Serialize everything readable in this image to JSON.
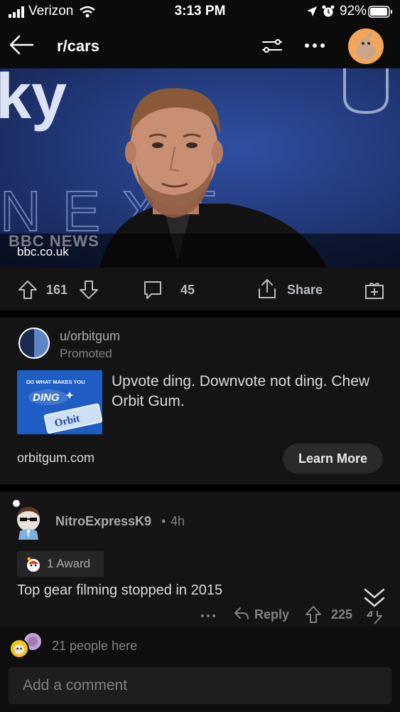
{
  "status": {
    "carrier": "Verizon",
    "time": "3:13 PM",
    "battery": "92%"
  },
  "header": {
    "title": "r/cars"
  },
  "post": {
    "domain": "bbc.co.uk",
    "watermark": "BBC NEWS",
    "upvotes": "161",
    "comments": "45",
    "share_label": "Share"
  },
  "promo": {
    "user": "u/orbitgum",
    "label": "Promoted",
    "headline": "Upvote ding. Downvote not ding. Chew Orbit Gum.",
    "ad_text_top": "DO WHAT MAKES YOU",
    "ad_text_main": "DING",
    "ad_brand": "Orbit",
    "domain": "orbitgum.com",
    "cta": "Learn More"
  },
  "comment": {
    "author": "NitroExpressK9",
    "separator": "•",
    "age": "4h",
    "award": "1 Award",
    "body": "Top gear filming stopped in 2015",
    "reply_label": "Reply",
    "score": "225"
  },
  "footer": {
    "people_here": "21 people here",
    "comment_placeholder": "Add a comment"
  },
  "colors": {
    "background": "#0b0b0b",
    "card": "#141414",
    "accent_avatar": "#f2a65a",
    "ad_blue": "#1e5dc4"
  }
}
